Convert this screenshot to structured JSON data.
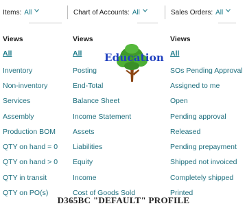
{
  "filters": [
    {
      "label": "Items:",
      "value": "All"
    },
    {
      "label": "Chart of Accounts:",
      "value": "All"
    },
    {
      "label": "Sales Orders:",
      "value": "All"
    }
  ],
  "columns": [
    {
      "heading": "Views",
      "items": [
        "All",
        "Inventory",
        "Non-inventory",
        "Services",
        "Assembly",
        "Production BOM",
        "QTY on hand = 0",
        "QTY on hand > 0",
        "QTY in transit",
        "QTY on PO(s)"
      ]
    },
    {
      "heading": "Views",
      "items": [
        "All",
        "Posting",
        "End-Total",
        "Balance Sheet",
        "Income Statement",
        "Assets",
        "Liabilities",
        "Equity",
        "Income",
        "Cost of Goods Sold"
      ]
    },
    {
      "heading": "Views",
      "items": [
        "All",
        "SOs Pending Approval",
        "Assigned to me",
        "Open",
        "Pending approval",
        "Released",
        "Pending prepayment",
        "Shipped not invoiced",
        "Completely shipped",
        "Printed"
      ]
    }
  ],
  "watermark": {
    "text": "Education",
    "colors": {
      "text": "#1f3fbf",
      "foliage": "#3f9a2a",
      "trunk": "#8b4513"
    }
  },
  "caption": "D365BC \"DEFAULT\" PROFILE",
  "colors": {
    "link": "#1e6f7e",
    "accent": "#1e7b8a",
    "separator": "#c8c8c8"
  }
}
